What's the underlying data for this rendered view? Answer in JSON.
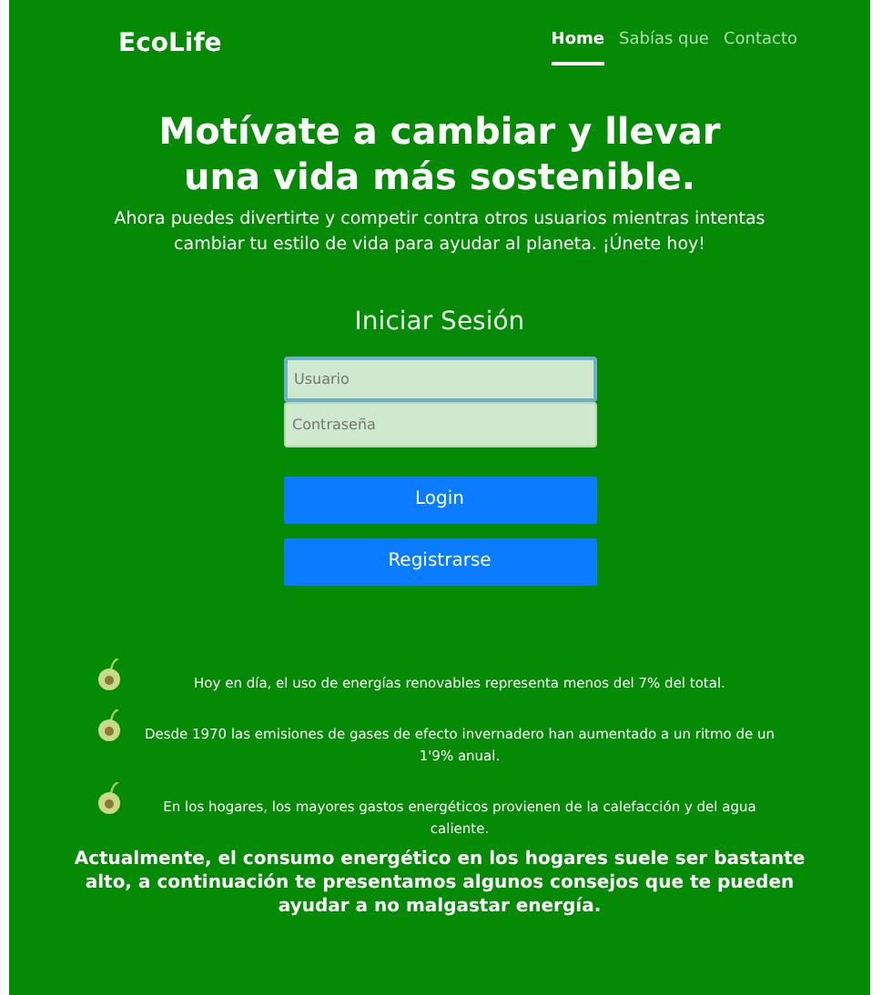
{
  "navbar": {
    "brand": "EcoLife",
    "links": [
      {
        "label": "Home",
        "selected": true
      },
      {
        "label": "Sabías que",
        "selected": false
      },
      {
        "label": "Contacto",
        "selected": false
      }
    ]
  },
  "hero": {
    "title": "Motívate a cambiar y llevar una vida más sostenible.",
    "subtitle": "Ahora puedes divertirte y competir contra otros usuarios mientras intentas cambiar tu estilo de vida para ayudar al planeta. ¡Únete hoy!"
  },
  "login": {
    "title": "Iniciar Sesión",
    "fields": [
      {
        "placeholder": "Usuario",
        "focused": true
      },
      {
        "placeholder": "Contraseña",
        "focused": false
      }
    ],
    "buttons": [
      "Login",
      "Registrarse"
    ]
  },
  "facts": [
    "Hoy en día, el uso de energías renovables representa menos del 7% del total.",
    "Desde 1970 las emisiones de gases de efecto invernadero han aumentado a un ritmo de un 1'9% anual.",
    "En los hogares, los mayores gastos energéticos provienen de la calefacción y del agua caliente."
  ],
  "closing": "Actualmente, el consumo energético en los hogares suele ser bastante alto, a continuación te presentamos algunos consejos que te pueden ayudar a no malgastar energía."
}
